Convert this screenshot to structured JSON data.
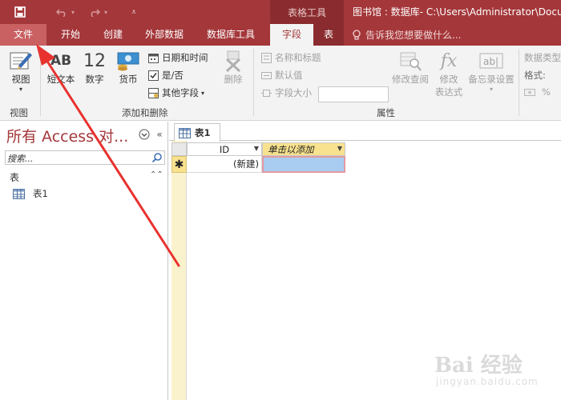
{
  "window": {
    "title": "图书馆 : 数据库- C:\\Users\\Administrator\\Docu",
    "context_tab_group": "表格工具"
  },
  "tabs": [
    {
      "label": "文件"
    },
    {
      "label": "开始"
    },
    {
      "label": "创建"
    },
    {
      "label": "外部数据"
    },
    {
      "label": "数据库工具"
    },
    {
      "label": "字段"
    },
    {
      "label": "表"
    }
  ],
  "tell_me": {
    "placeholder": "告诉我您想要做什么..."
  },
  "ribbon": {
    "view": {
      "label": "视图",
      "group": "视图"
    },
    "add_delete": {
      "group": "添加和删除",
      "short_text": "短文本",
      "short_text_icon": "AB",
      "number": "数字",
      "number_icon": "12",
      "currency": "货币",
      "datetime": "日期和时间",
      "yesno": "是/否",
      "more_fields": "其他字段",
      "delete": "删除"
    },
    "properties": {
      "group": "属性",
      "name_caption": "名称和标题",
      "default_value": "默认值",
      "field_size": "字段大小",
      "modify_lookups": "修改查阅",
      "modify_expression": [
        "修改",
        "表达式"
      ],
      "memo_settings": "备忘录设置"
    },
    "formatting": {
      "data_type_label": "数据类型",
      "format_label": "格式:",
      "percent": "%"
    }
  },
  "nav_pane": {
    "header": "所有 Access 对...",
    "search_placeholder": "搜索...",
    "group": "表",
    "items": [
      {
        "label": "表1"
      }
    ]
  },
  "document": {
    "tab_label": "表1",
    "columns": [
      {
        "label": "ID"
      },
      {
        "label": "单击以添加"
      }
    ],
    "new_row": {
      "id_value": "(新建)",
      "marker": "✱"
    }
  },
  "watermark": {
    "brand": "Bai 经验",
    "url": "jingyan.baidu.com"
  },
  "colors": {
    "accent": "#a4373a",
    "accent_dark": "#8a2c2f",
    "file_tab": "#c96062",
    "ribbon_bg": "#f3f3f3",
    "header_yellow": "#f8e28f",
    "selection_blue": "#a8cdf0",
    "arrow_red": "#e8322f"
  }
}
